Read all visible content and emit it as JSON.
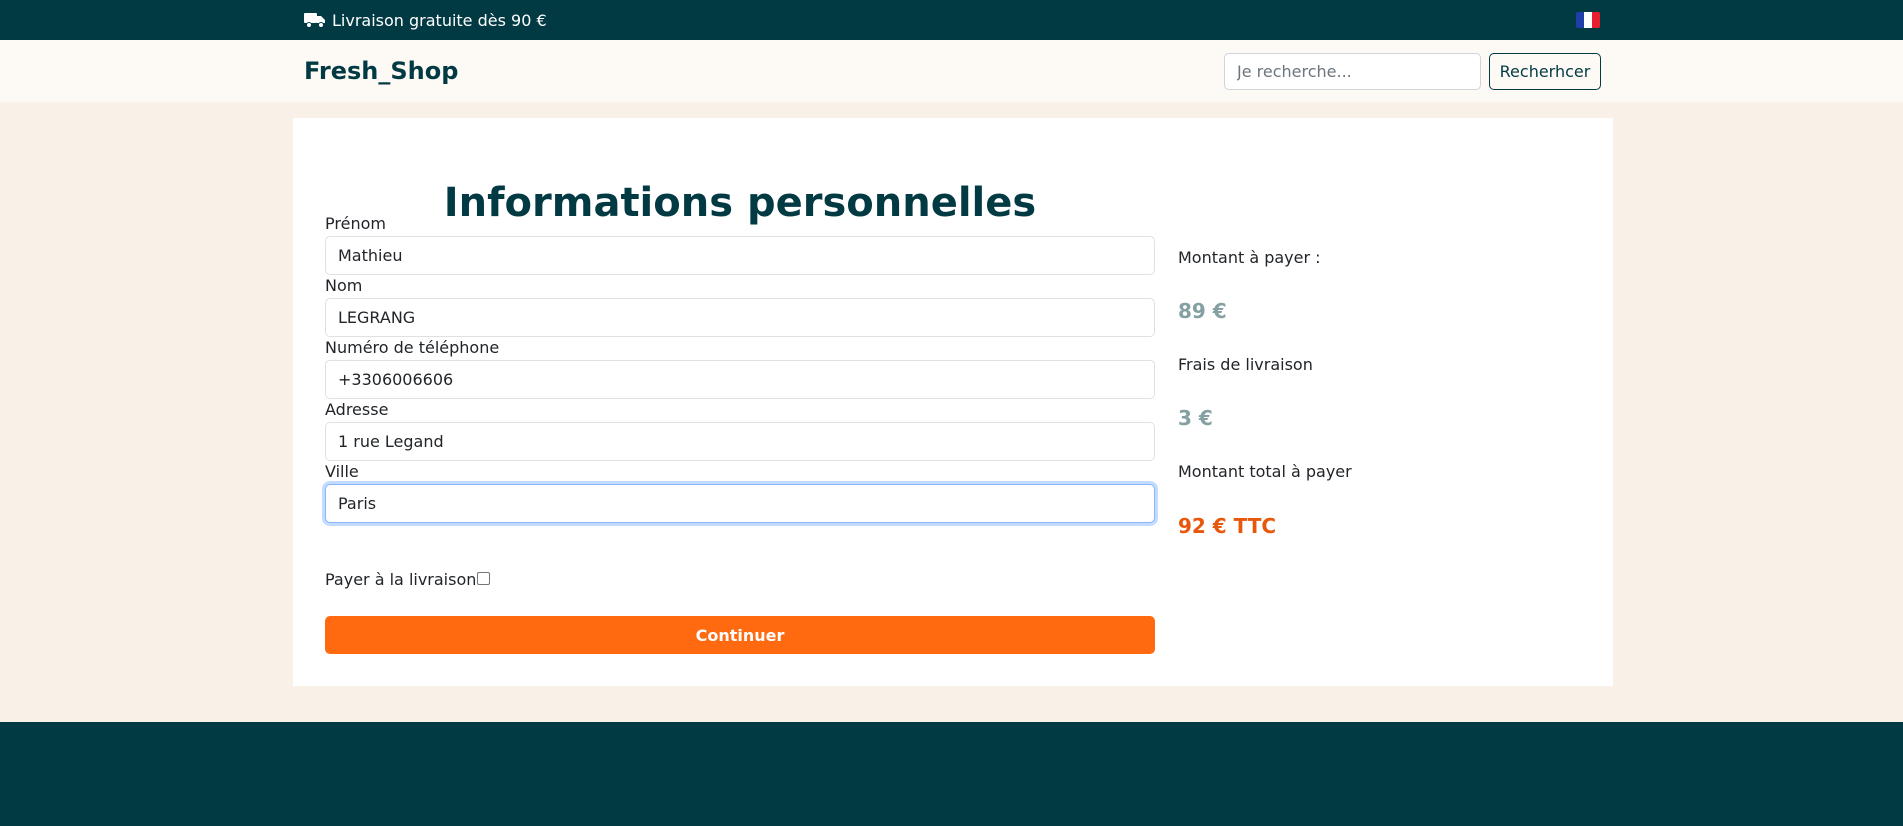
{
  "topbar": {
    "delivery_text": "Livraison gratuite dès 90 €",
    "truck_icon": "truck-icon",
    "language_flag": "flag-fr-icon",
    "colors": {
      "background": "#023a44",
      "text": "#ffffff"
    }
  },
  "header": {
    "brand": "Fresh_Shop",
    "search": {
      "placeholder": "Je recherche...",
      "value": ""
    },
    "search_button": "Recherhcer"
  },
  "form": {
    "title": "Informations personnelles",
    "fields": [
      {
        "label": "Prénom",
        "value": "Mathieu"
      },
      {
        "label": "Nom",
        "value": "LEGRANG"
      },
      {
        "label": "Numéro de téléphone",
        "value": "+3306006606"
      },
      {
        "label": "Adresse",
        "value": "1 rue Legand"
      },
      {
        "label": "Ville",
        "value": "Paris",
        "focused": true
      }
    ],
    "cod_label": "Payer à la livraison",
    "cod_checked": false,
    "continue_button": "Continuer"
  },
  "summary": {
    "amount_label": "Montant à payer :",
    "amount_value": "89 €",
    "shipping_label": "Frais de livraison",
    "shipping_value": "3 €",
    "total_label": "Montant total à payer",
    "total_value": "92 € TTC"
  },
  "colors": {
    "brand": "#023a44",
    "accent": "#ff6a10",
    "page_background": "#f9f1e7",
    "muted_amount": "#84a0a3",
    "total_amount": "#e8580c"
  }
}
